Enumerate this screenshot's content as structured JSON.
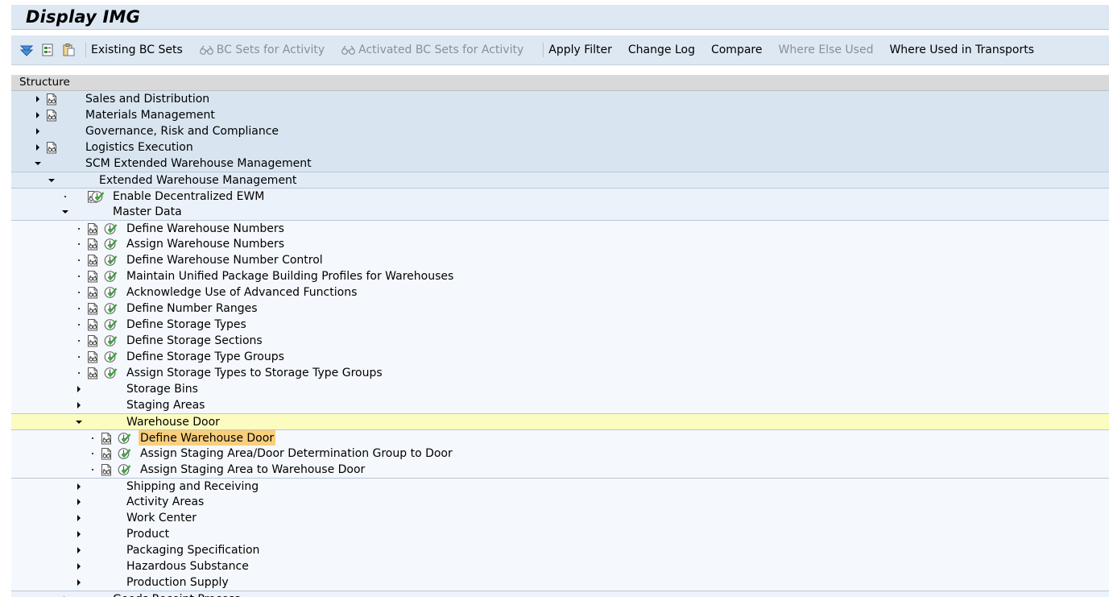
{
  "window": {
    "title": "Display IMG"
  },
  "toolbar": {
    "icons": [
      "filter-icon",
      "tree-expand-icon",
      "clipboard-icon"
    ],
    "buttons": [
      {
        "label": "Existing BC Sets",
        "enabled": true,
        "icon": null
      },
      {
        "label": "BC Sets for Activity",
        "enabled": false,
        "icon": "glasses-icon"
      },
      {
        "label": "Activated BC Sets for Activity",
        "enabled": false,
        "icon": "glasses-icon"
      },
      {
        "label": "Apply Filter",
        "enabled": true,
        "icon": null
      },
      {
        "label": "Change Log",
        "enabled": true,
        "icon": null
      },
      {
        "label": "Compare",
        "enabled": true,
        "icon": null
      },
      {
        "label": "Where Else Used",
        "enabled": false,
        "icon": null
      },
      {
        "label": "Where Used in Transports",
        "enabled": true,
        "icon": null
      }
    ]
  },
  "tree": {
    "header": "Structure",
    "rows": [
      {
        "label": "Sales and Distribution",
        "level": 0,
        "node": "collapsed",
        "doc": true,
        "act": false
      },
      {
        "label": "Materials Management",
        "level": 0,
        "node": "collapsed",
        "doc": true,
        "act": false
      },
      {
        "label": "Governance, Risk and Compliance",
        "level": 0,
        "node": "collapsed",
        "doc": false,
        "act": false
      },
      {
        "label": "Logistics Execution",
        "level": 0,
        "node": "collapsed",
        "doc": true,
        "act": false
      },
      {
        "label": "SCM Extended Warehouse Management",
        "level": 0,
        "node": "expanded",
        "doc": false,
        "act": false
      },
      {
        "label": "Extended Warehouse Management",
        "level": 1,
        "node": "expanded",
        "doc": false,
        "act": false
      },
      {
        "label": "Enable Decentralized EWM",
        "level": 2,
        "node": "leaf",
        "doc": true,
        "act": true
      },
      {
        "label": "Master Data",
        "level": 2,
        "node": "expanded",
        "doc": false,
        "act": false
      },
      {
        "label": "Define Warehouse Numbers",
        "level": 3,
        "node": "leaf",
        "doc": true,
        "act": true
      },
      {
        "label": "Assign Warehouse Numbers",
        "level": 3,
        "node": "leaf",
        "doc": true,
        "act": true
      },
      {
        "label": "Define Warehouse Number Control",
        "level": 3,
        "node": "leaf",
        "doc": true,
        "act": true
      },
      {
        "label": "Maintain Unified Package Building Profiles for Warehouses",
        "level": 3,
        "node": "leaf",
        "doc": true,
        "act": true
      },
      {
        "label": "Acknowledge Use of Advanced Functions",
        "level": 3,
        "node": "leaf",
        "doc": true,
        "act": true
      },
      {
        "label": "Define Number Ranges",
        "level": 3,
        "node": "leaf",
        "doc": true,
        "act": true
      },
      {
        "label": "Define Storage Types",
        "level": 3,
        "node": "leaf",
        "doc": true,
        "act": true
      },
      {
        "label": "Define Storage Sections",
        "level": 3,
        "node": "leaf",
        "doc": true,
        "act": true
      },
      {
        "label": "Define Storage Type Groups",
        "level": 3,
        "node": "leaf",
        "doc": true,
        "act": true
      },
      {
        "label": "Assign Storage Types to Storage Type Groups",
        "level": 3,
        "node": "leaf",
        "doc": true,
        "act": true
      },
      {
        "label": "Storage Bins",
        "level": 3,
        "node": "collapsed",
        "doc": false,
        "act": false
      },
      {
        "label": "Staging Areas",
        "level": 3,
        "node": "collapsed",
        "doc": false,
        "act": false
      },
      {
        "label": "Warehouse Door",
        "level": 3,
        "node": "expanded",
        "doc": false,
        "act": false,
        "selected": true
      },
      {
        "label": "Define Warehouse Door",
        "level": 4,
        "node": "leaf",
        "doc": true,
        "act": true,
        "highlighted": true
      },
      {
        "label": "Assign Staging Area/Door Determination Group to Door",
        "level": 4,
        "node": "leaf",
        "doc": true,
        "act": true
      },
      {
        "label": "Assign Staging Area to Warehouse Door",
        "level": 4,
        "node": "leaf",
        "doc": true,
        "act": true
      },
      {
        "label": "Shipping and Receiving",
        "level": 3,
        "node": "collapsed",
        "doc": false,
        "act": false
      },
      {
        "label": "Activity Areas",
        "level": 3,
        "node": "collapsed",
        "doc": false,
        "act": false
      },
      {
        "label": "Work Center",
        "level": 3,
        "node": "collapsed",
        "doc": false,
        "act": false
      },
      {
        "label": "Product",
        "level": 3,
        "node": "collapsed",
        "doc": false,
        "act": false
      },
      {
        "label": "Packaging Specification",
        "level": 3,
        "node": "collapsed",
        "doc": false,
        "act": false
      },
      {
        "label": "Hazardous Substance",
        "level": 3,
        "node": "collapsed",
        "doc": false,
        "act": false
      },
      {
        "label": "Production Supply",
        "level": 3,
        "node": "collapsed",
        "doc": false,
        "act": false
      },
      {
        "label": "Goods Receipt Process",
        "level": 2,
        "node": "collapsed",
        "doc": false,
        "act": false
      }
    ]
  }
}
